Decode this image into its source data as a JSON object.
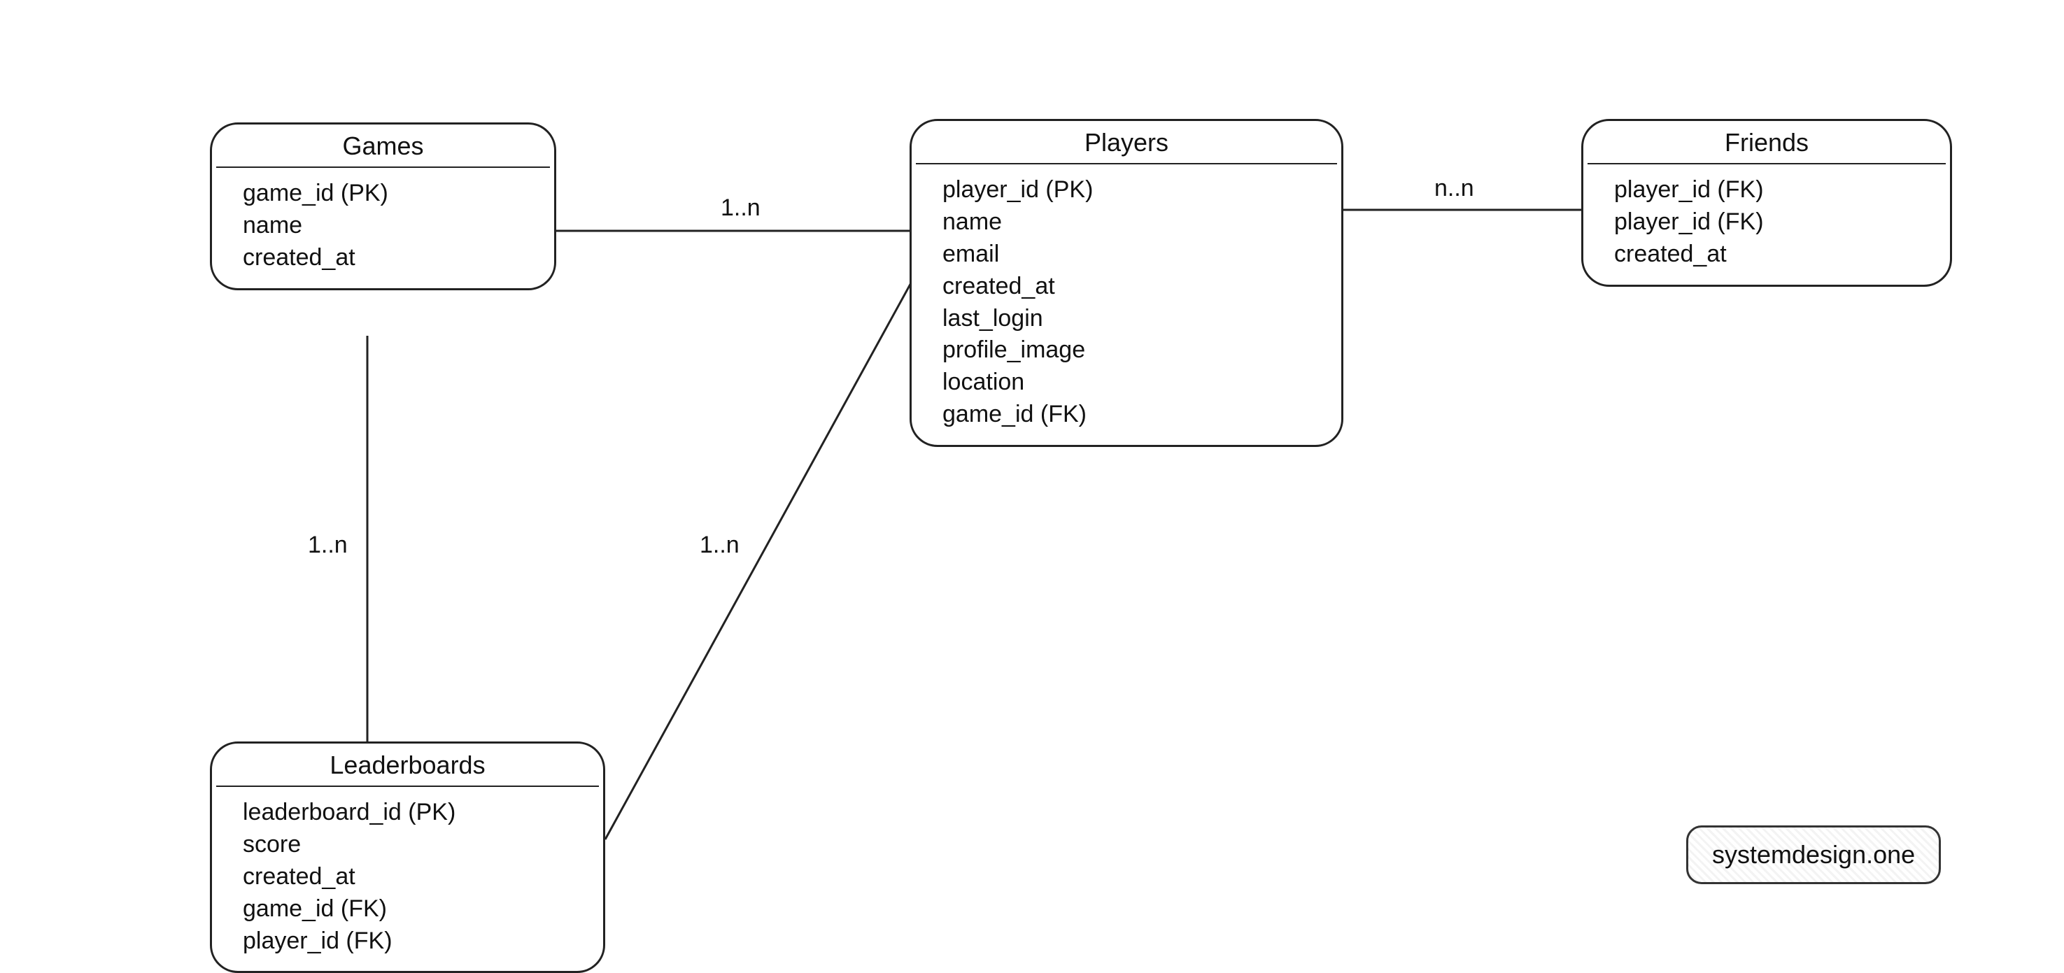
{
  "entities": {
    "games": {
      "title": "Games",
      "fields": [
        "game_id (PK)",
        "name",
        "created_at"
      ]
    },
    "players": {
      "title": "Players",
      "fields": [
        "player_id (PK)",
        "name",
        "email",
        "created_at",
        "last_login",
        "profile_image",
        "location",
        "game_id (FK)"
      ]
    },
    "friends": {
      "title": "Friends",
      "fields": [
        "player_id (FK)",
        "player_id (FK)",
        "created_at"
      ]
    },
    "leaderboards": {
      "title": "Leaderboards",
      "fields": [
        "leaderboard_id (PK)",
        "score",
        "created_at",
        "game_id (FK)",
        "player_id (FK)"
      ]
    }
  },
  "relations": {
    "games_players": "1..n",
    "games_leaderboards": "1..n",
    "players_leaderboards": "1..n",
    "players_friends": "n..n"
  },
  "watermark": "systemdesign.one"
}
